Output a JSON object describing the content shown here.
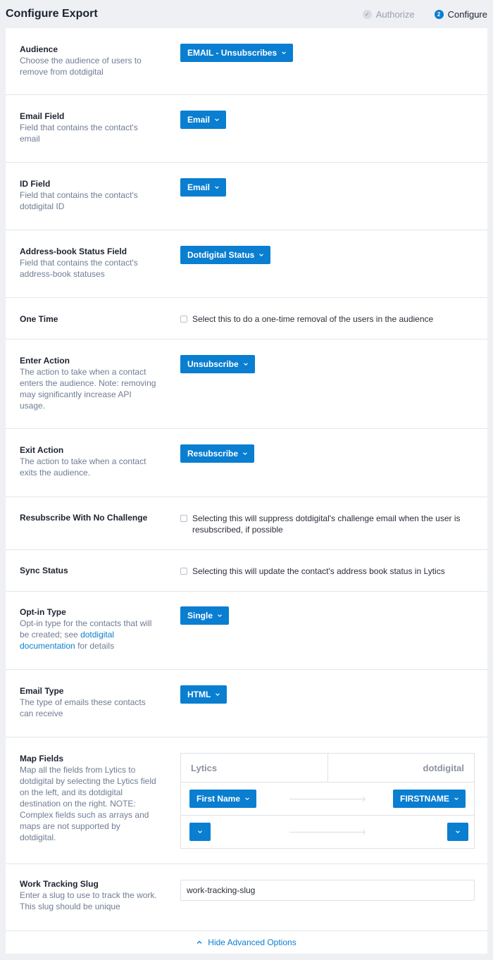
{
  "header": {
    "title": "Configure Export",
    "steps": [
      {
        "number": "✓",
        "label": "Authorize"
      },
      {
        "number": "2",
        "label": "Configure"
      }
    ]
  },
  "fields": {
    "audience": {
      "title": "Audience",
      "desc": "Choose the audience of users to remove from dotdigital",
      "value": "EMAIL - Unsubscribes"
    },
    "email_field": {
      "title": "Email Field",
      "desc": "Field that contains the contact's email",
      "value": "Email"
    },
    "id_field": {
      "title": "ID Field",
      "desc": "Field that contains the contact's dotdigital ID",
      "value": "Email"
    },
    "status_field": {
      "title": "Address-book Status Field",
      "desc": "Field that contains the contact's address-book statuses",
      "value": "Dotdigital Status"
    },
    "one_time": {
      "title": "One Time",
      "checkbox_label": "Select this to do a one-time removal of the users in the audience"
    },
    "enter_action": {
      "title": "Enter Action",
      "desc": "The action to take when a contact enters the audience. Note: removing may significantly increase API usage.",
      "value": "Unsubscribe"
    },
    "exit_action": {
      "title": "Exit Action",
      "desc": "The action to take when a contact exits the audience.",
      "value": "Resubscribe"
    },
    "resubscribe": {
      "title": "Resubscribe With No Challenge",
      "checkbox_label": "Selecting this will suppress dotdigital's challenge email when the user is resubscribed, if possible"
    },
    "sync_status": {
      "title": "Sync Status",
      "checkbox_label": "Selecting this will update the contact's address book status in Lytics"
    },
    "optin_type": {
      "title": "Opt-in Type",
      "desc_prefix": "Opt-in type for the contacts that will be created; see ",
      "desc_link": "dotdigital documentation",
      "desc_suffix": " for details",
      "value": "Single"
    },
    "email_type": {
      "title": "Email Type",
      "desc": "The type of emails these contacts can receive",
      "value": "HTML"
    },
    "map_fields": {
      "title": "Map Fields",
      "desc": "Map all the fields from Lytics to dotdigital by selecting the Lytics field on the left, and its dotdigital destination on the right. NOTE: Complex fields such as arrays and maps are not supported by dotdigital.",
      "left_header": "Lytics",
      "right_header": "dotdigital",
      "rows": [
        {
          "left": "First Name",
          "right": "FIRSTNAME"
        },
        {
          "left": "",
          "right": ""
        }
      ]
    },
    "slug": {
      "title": "Work Tracking Slug",
      "desc": "Enter a slug to use to track the work. This slug should be unique",
      "value": "work-tracking-slug"
    }
  },
  "footer": {
    "label": "Hide Advanced Options"
  },
  "colors": {
    "accent": "#0a7ed0",
    "background": "#eef0f4"
  }
}
